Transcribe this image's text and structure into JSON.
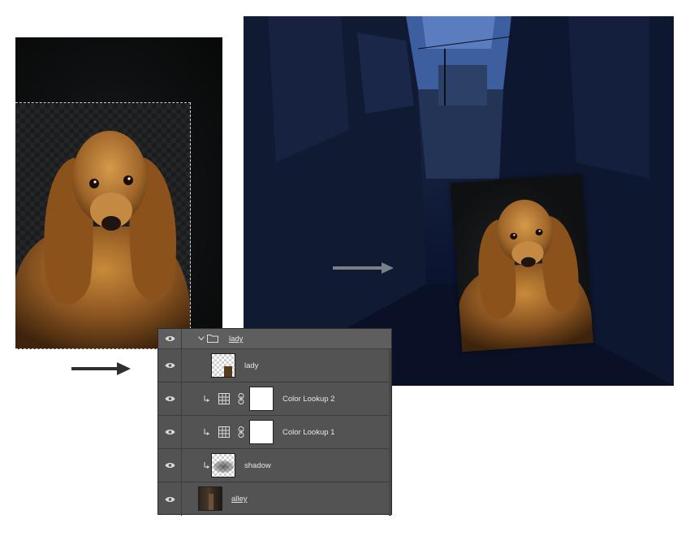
{
  "layers_panel": {
    "group": {
      "name": "lady",
      "icon": "folder-icon",
      "expand_icon": "chevron-down-icon"
    },
    "layers": [
      {
        "name": "lady",
        "type": "pixel",
        "visible": true
      },
      {
        "name": "Color Lookup 2",
        "type": "adjustment",
        "clipped": true,
        "visible": true
      },
      {
        "name": "Color Lookup 1",
        "type": "adjustment",
        "clipped": true,
        "visible": true
      },
      {
        "name": "shadow",
        "type": "pixel",
        "clipped": true,
        "visible": true
      },
      {
        "name": "alley",
        "type": "pixel",
        "visible": true
      }
    ]
  },
  "icons": {
    "visibility": "eye-icon",
    "adjustment": "color-lookup-grid-icon",
    "link": "chain-link-icon",
    "clip": "clipping-arrow-icon",
    "arrows": "right-arrow-icon"
  },
  "colors": {
    "panel_bg": "#535353",
    "scene_tint": "#0b1430"
  }
}
